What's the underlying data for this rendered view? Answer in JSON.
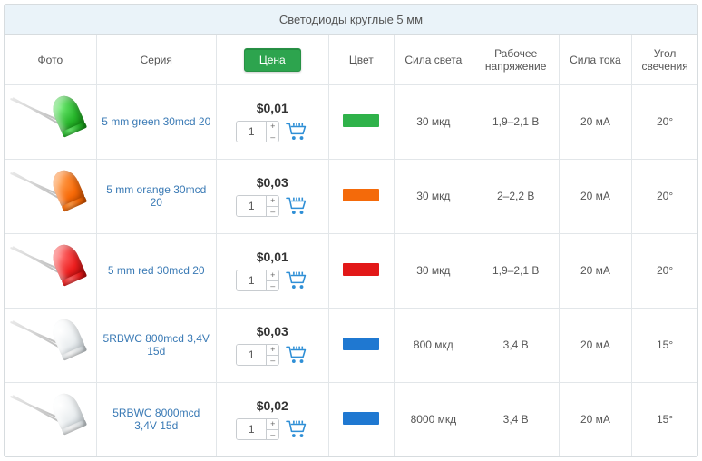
{
  "title": "Светодиоды круглые 5 мм",
  "headers": {
    "photo": "Фото",
    "series": "Серия",
    "price": "Цена",
    "color": "Цвет",
    "luminance": "Сила света",
    "voltage": "Рабочее напряжение",
    "current": "Сила тока",
    "angle": "Угол свечения"
  },
  "chip_colors": {
    "green": "#2fb24a",
    "orange": "#f46a0a",
    "red": "#e21818",
    "blue": "#1f78d1"
  },
  "rows": [
    {
      "led_class": "green",
      "series": "5 mm green 30mcd 20",
      "price": "$0,01",
      "qty": "1",
      "chip": "green",
      "luminance": "30 мкд",
      "voltage": "1,9–2,1 В",
      "current": "20 мА",
      "angle": "20°"
    },
    {
      "led_class": "orange",
      "series": "5 mm orange 30mcd 20",
      "price": "$0,03",
      "qty": "1",
      "chip": "orange",
      "luminance": "30 мкд",
      "voltage": "2–2,2 В",
      "current": "20 мА",
      "angle": "20°"
    },
    {
      "led_class": "red",
      "series": "5 mm red 30mcd 20",
      "price": "$0,01",
      "qty": "1",
      "chip": "red",
      "luminance": "30 мкд",
      "voltage": "1,9–2,1 В",
      "current": "20 мА",
      "angle": "20°"
    },
    {
      "led_class": "clear",
      "series": "5RBWC 800mcd 3,4V 15d",
      "price": "$0,03",
      "qty": "1",
      "chip": "blue",
      "luminance": "800 мкд",
      "voltage": "3,4 В",
      "current": "20 мА",
      "angle": "15°"
    },
    {
      "led_class": "clear",
      "series": "5RBWC 8000mcd 3,4V 15d",
      "price": "$0,02",
      "qty": "1",
      "chip": "blue",
      "luminance": "8000 мкд",
      "voltage": "3,4 В",
      "current": "20 мА",
      "angle": "15°"
    }
  ]
}
